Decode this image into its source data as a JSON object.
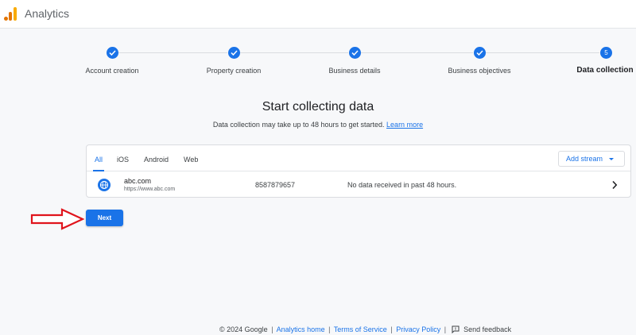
{
  "header": {
    "app_title": "Analytics"
  },
  "stepper": {
    "steps": [
      {
        "label": "Account creation",
        "state": "done"
      },
      {
        "label": "Property creation",
        "state": "done"
      },
      {
        "label": "Business details",
        "state": "done"
      },
      {
        "label": "Business objectives",
        "state": "done"
      },
      {
        "label": "Data collection",
        "state": "current",
        "number": "5"
      }
    ]
  },
  "main": {
    "title": "Start collecting data",
    "subtitle": "Data collection may take up to 48 hours to get started.",
    "learn_more": "Learn more"
  },
  "streams": {
    "tabs": [
      {
        "label": "All",
        "active": true
      },
      {
        "label": "iOS",
        "active": false
      },
      {
        "label": "Android",
        "active": false
      },
      {
        "label": "Web",
        "active": false
      }
    ],
    "add_stream_label": "Add stream",
    "rows": [
      {
        "name": "abc.com",
        "url": "https://www.abc.com",
        "stream_id": "8587879657",
        "status": "No data received in past 48 hours."
      }
    ]
  },
  "actions": {
    "next_label": "Next"
  },
  "footer": {
    "copyright": "© 2024 Google",
    "analytics_home": "Analytics home",
    "terms": "Terms of Service",
    "privacy": "Privacy Policy",
    "feedback": "Send feedback",
    "separator": "|"
  },
  "colors": {
    "accent": "#1a73e8",
    "annotation_arrow": "#e0141c"
  }
}
